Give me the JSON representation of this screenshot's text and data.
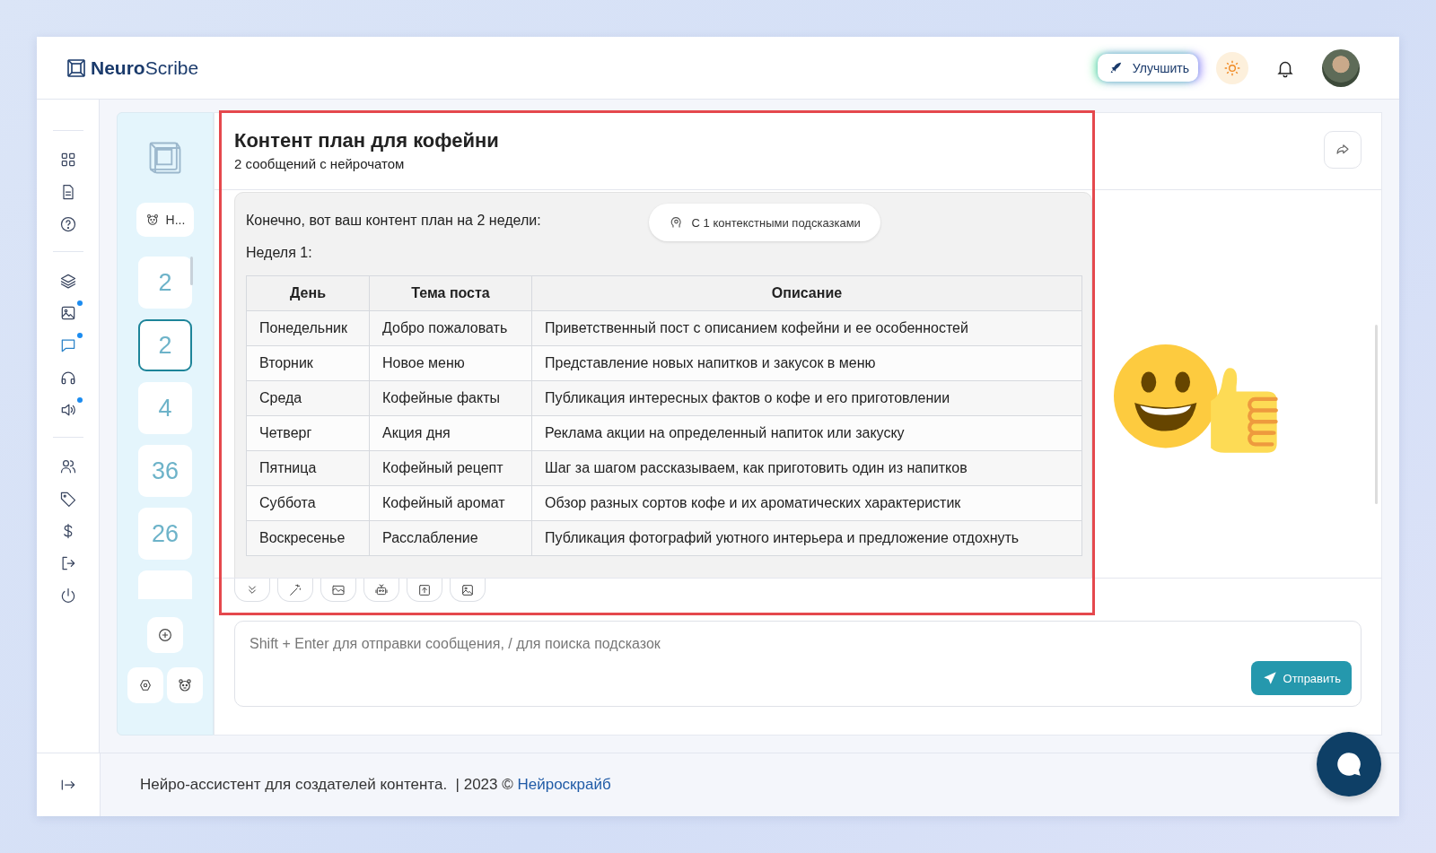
{
  "header": {
    "logo": "**Neuro**Scribe",
    "upgrade_button": "Улучшить"
  },
  "nav": {
    "groups": [
      [
        {
          "kind": "grid",
          "active": false,
          "dot": false
        },
        {
          "kind": "doc",
          "active": false,
          "dot": false
        },
        {
          "kind": "help",
          "active": false,
          "dot": false
        }
      ],
      [
        {
          "kind": "layers",
          "active": false,
          "dot": false
        },
        {
          "kind": "image",
          "active": false,
          "dot": true
        },
        {
          "kind": "chat",
          "active": true,
          "dot": true
        },
        {
          "kind": "headphones",
          "active": false,
          "dot": false
        },
        {
          "kind": "speaker",
          "active": false,
          "dot": true
        }
      ],
      [
        {
          "kind": "users",
          "active": false,
          "dot": false
        },
        {
          "kind": "tag",
          "active": false,
          "dot": false
        },
        {
          "kind": "dollar",
          "active": false,
          "dot": false
        },
        {
          "kind": "logout",
          "active": false,
          "dot": false
        },
        {
          "kind": "power",
          "active": false,
          "dot": false
        }
      ]
    ]
  },
  "chat_list": {
    "assistant": "Н...",
    "chats": [
      {
        "label": "2",
        "selected": false
      },
      {
        "label": "2",
        "selected": true
      },
      {
        "label": "4",
        "selected": false
      },
      {
        "label": "36",
        "selected": false
      },
      {
        "label": "26",
        "selected": false
      },
      {
        "selected": false
      }
    ]
  },
  "chat": {
    "title": "Контент план для кофейни",
    "subtitle": "2 сообщений с нейрочатом",
    "message": {
      "intro": "Конечно, вот ваш контент план на 2 недели:",
      "hints_badge": "С 1 контекстными подсказками",
      "week": "Неделя 1:",
      "table": {
        "columns": [
          "День",
          "Тема поста",
          "Описание"
        ],
        "rows": [
          [
            "Понедельник",
            "Добро пожаловать",
            "Приветственный пост с описанием кофейни и ее особенностей"
          ],
          [
            "Вторник",
            "Новое меню",
            "Представление новых напитков и закусок в меню"
          ],
          [
            "Среда",
            "Кофейные факты",
            "Публикация интересных фактов о кофе и его приготовлении"
          ],
          [
            "Четверг",
            "Акция дня",
            "Реклама акции на определенный напиток или закуску"
          ],
          [
            "Пятница",
            "Кофейный рецепт",
            "Шаг за шагом рассказываем, как приготовить один из напитков"
          ],
          [
            "Суббота",
            "Кофейный аромат",
            "Обзор разных сортов кофе и их ароматических характеристик"
          ],
          [
            "Воскресенье",
            "Расслабление",
            "Публикация фотографий уютного интерьера и предложение отдохнуть"
          ]
        ]
      }
    },
    "tools": [
      {
        "kind": "chevrons"
      },
      {
        "kind": "wand"
      },
      {
        "kind": "mail"
      },
      {
        "kind": "robot"
      },
      {
        "kind": "upload"
      },
      {
        "kind": "image"
      }
    ],
    "input": {
      "placeholder": "Shift + Enter для отправки сообщения, / для поиска подсказок"
    },
    "send_button": "Отправить"
  },
  "footer": {
    "text": "Нейро-ассистент для создателей контента.  | 2023 © ",
    "link": "Нейроскрайб"
  },
  "highlight": true
}
